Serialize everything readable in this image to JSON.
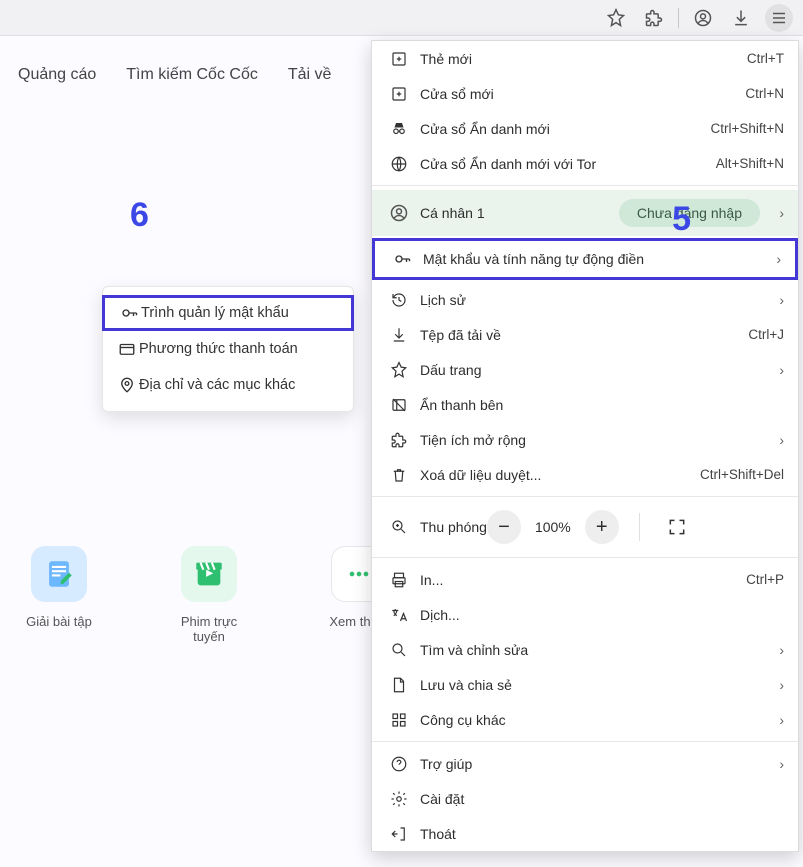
{
  "homeLinks": [
    "Quảng cáo",
    "Tìm kiếm Cốc Cốc",
    "Tải về"
  ],
  "callouts": {
    "six": "6",
    "five": "5"
  },
  "submenu": {
    "password": "Trình quản lý mật khẩu",
    "payment": "Phương thức thanh toán",
    "address": "Địa chỉ và các mục khác"
  },
  "tiles": {
    "homework": "Giải bài tập",
    "movies": "Phim trực tuyến",
    "more": "Xem thêm"
  },
  "menu": {
    "newTab": {
      "label": "Thẻ mới",
      "shortcut": "Ctrl+T"
    },
    "newWindow": {
      "label": "Cửa sổ mới",
      "shortcut": "Ctrl+N"
    },
    "newIncognito": {
      "label": "Cửa sổ Ẩn danh mới",
      "shortcut": "Ctrl+Shift+N"
    },
    "newTor": {
      "label": "Cửa sổ Ẩn danh mới với Tor",
      "shortcut": "Alt+Shift+N"
    },
    "profile": {
      "label": "Cá nhân 1",
      "badge": "Chưa đăng nhập"
    },
    "passwords": {
      "label": "Mật khẩu và tính năng tự động điền"
    },
    "history": {
      "label": "Lịch sử"
    },
    "downloads": {
      "label": "Tệp đã tải về",
      "shortcut": "Ctrl+J"
    },
    "bookmarks": {
      "label": "Dấu trang"
    },
    "hideSidebar": {
      "label": "Ẩn thanh bên"
    },
    "extensions": {
      "label": "Tiện ích mở rộng"
    },
    "clearData": {
      "label": "Xoá dữ liệu duyệt...",
      "shortcut": "Ctrl+Shift+Del"
    },
    "zoom": {
      "label": "Thu phóng",
      "value": "100%"
    },
    "print": {
      "label": "In...",
      "shortcut": "Ctrl+P"
    },
    "translate": {
      "label": "Dịch..."
    },
    "find": {
      "label": "Tìm và chỉnh sửa"
    },
    "saveShare": {
      "label": "Lưu và chia sẻ"
    },
    "moreTools": {
      "label": "Công cụ khác"
    },
    "help": {
      "label": "Trợ giúp"
    },
    "settings": {
      "label": "Cài đặt"
    },
    "exit": {
      "label": "Thoát"
    }
  }
}
